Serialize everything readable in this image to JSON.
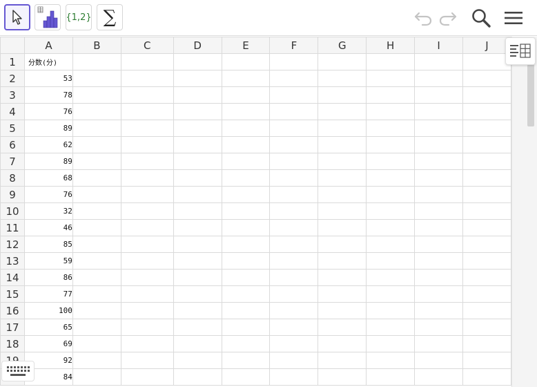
{
  "toolbar": {
    "list_label": "{1,2}"
  },
  "columns": [
    "A",
    "B",
    "C",
    "D",
    "E",
    "F",
    "G",
    "H",
    "I",
    "J"
  ],
  "rows": [
    {
      "num": "1",
      "a": "分数(分)"
    },
    {
      "num": "2",
      "a": "53"
    },
    {
      "num": "3",
      "a": "78"
    },
    {
      "num": "4",
      "a": "76"
    },
    {
      "num": "5",
      "a": "89"
    },
    {
      "num": "6",
      "a": "62"
    },
    {
      "num": "7",
      "a": "89"
    },
    {
      "num": "8",
      "a": "68"
    },
    {
      "num": "9",
      "a": "76"
    },
    {
      "num": "10",
      "a": "32"
    },
    {
      "num": "11",
      "a": "46"
    },
    {
      "num": "12",
      "a": "85"
    },
    {
      "num": "13",
      "a": "59"
    },
    {
      "num": "14",
      "a": "86"
    },
    {
      "num": "15",
      "a": "77"
    },
    {
      "num": "16",
      "a": "100"
    },
    {
      "num": "17",
      "a": "65"
    },
    {
      "num": "18",
      "a": "69"
    },
    {
      "num": "19",
      "a": "92"
    },
    {
      "num": "20",
      "a": "84"
    }
  ],
  "colors": {
    "accent": "#6557d2",
    "bar_chart": "#6557d2",
    "list_text": "#2e7d32",
    "disabled_icon": "#c4c4c4"
  },
  "icons": [
    "move-tool-icon",
    "bar-chart-tool-icon",
    "sum-tool-icon",
    "undo-icon",
    "redo-icon",
    "search-icon",
    "menu-icon",
    "style-bar-icon",
    "keyboard-icon"
  ]
}
